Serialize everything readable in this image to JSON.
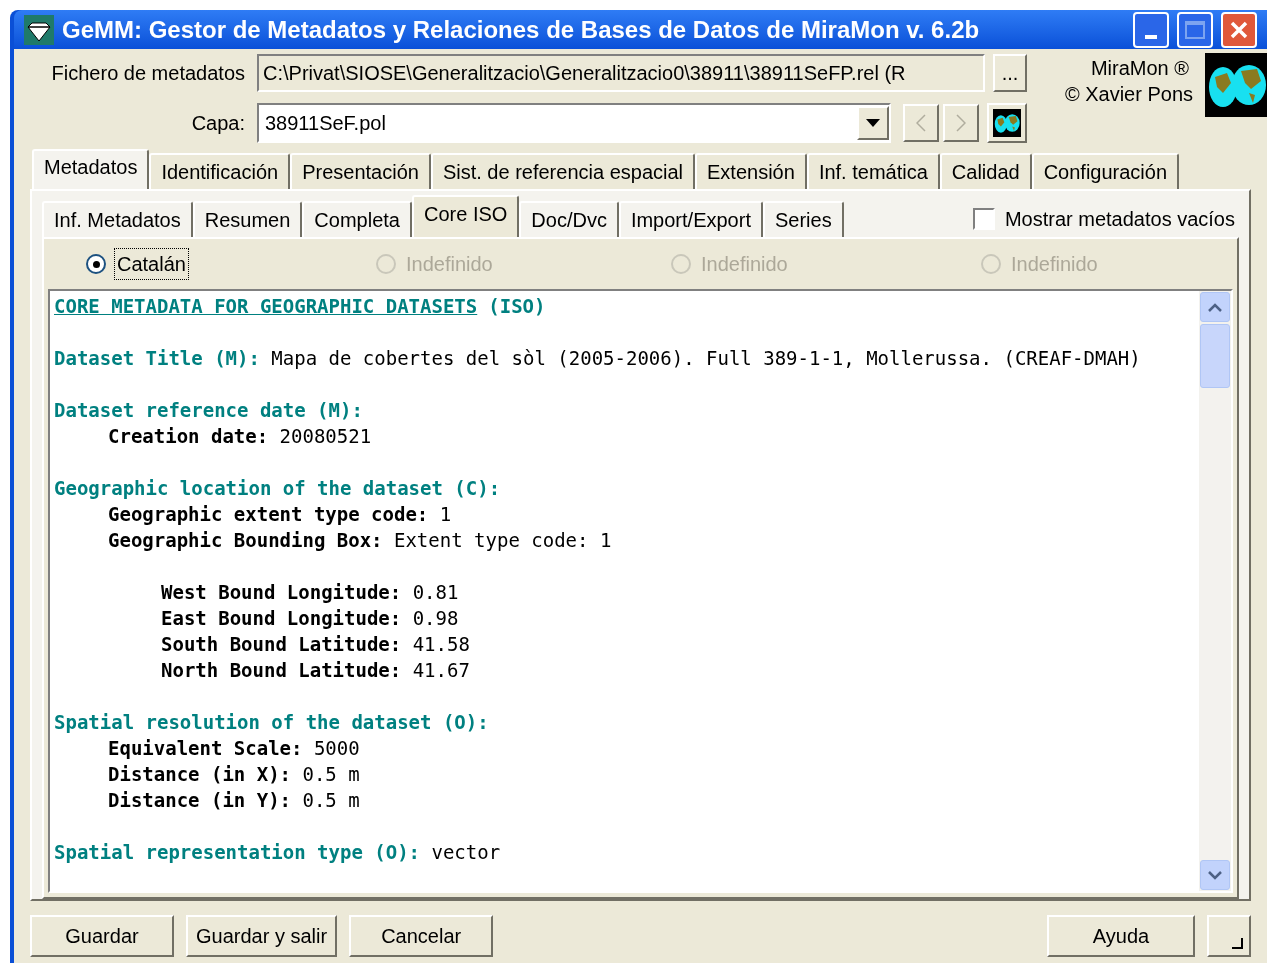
{
  "window": {
    "title": "GeMM: Gestor de Metadatos y Relaciones de Bases de Datos de MiraMon v. 6.2b"
  },
  "file_field": {
    "label": "Fichero de metadatos",
    "value": "C:\\Privat\\SIOSE\\Generalitzacio\\Generalitzacio0\\38911\\38911SeFP.rel (R",
    "browse_button": "..."
  },
  "brand": {
    "line_1": "MiraMon ®",
    "line_2": "© Xavier Pons"
  },
  "layer": {
    "label": "Capa:",
    "value": "38911SeF.pol"
  },
  "main_tabs": [
    {
      "label": "Metadatos",
      "selected": true
    },
    {
      "label": "Identificación",
      "selected": false
    },
    {
      "label": "Presentación",
      "selected": false
    },
    {
      "label": "Sist. de referencia espacial",
      "selected": false
    },
    {
      "label": "Extensión",
      "selected": false
    },
    {
      "label": "Inf. temática",
      "selected": false
    },
    {
      "label": "Calidad",
      "selected": false
    },
    {
      "label": "Configuración",
      "selected": false
    }
  ],
  "sub_tabs": [
    {
      "label": "Inf. Metadatos",
      "selected": false
    },
    {
      "label": "Resumen",
      "selected": false
    },
    {
      "label": "Completa",
      "selected": false
    },
    {
      "label": "Core ISO",
      "selected": true
    },
    {
      "label": "Doc/Dvc",
      "selected": false
    },
    {
      "label": "Import/Export",
      "selected": false
    },
    {
      "label": "Series",
      "selected": false
    }
  ],
  "show_empty": {
    "label": "Mostrar metadatos vacíos",
    "checked": false
  },
  "languages": [
    {
      "label": "Catalán",
      "selected": true,
      "disabled": false
    },
    {
      "label": "Indefinido",
      "selected": false,
      "disabled": true
    },
    {
      "label": "Indefinido",
      "selected": false,
      "disabled": true
    },
    {
      "label": "Indefinido",
      "selected": false,
      "disabled": true
    }
  ],
  "document": [
    {
      "kind": "title",
      "link": "CORE METADATA FOR GEOGRAPHIC DATASETS",
      "suffix": "(ISO)"
    },
    {
      "kind": "section",
      "heading": "Dataset Title (M):",
      "value": "Mapa de cobertes del sòl (2005-2006). Full 389-1-1, Mollerussa. (CREAF-DMAH)"
    },
    {
      "kind": "section",
      "heading": "Dataset reference date (M):",
      "children": [
        {
          "label": "Creation date:",
          "value": "20080521"
        }
      ]
    },
    {
      "kind": "section",
      "heading": "Geographic location of the dataset (C):",
      "children": [
        {
          "label": "Geographic extent type code:",
          "value": "1"
        },
        {
          "label": "Geographic Bounding Box:",
          "value": "Extent type code: 1",
          "children": [
            {
              "label": "West Bound Longitude:",
              "value": "0.81"
            },
            {
              "label": "East Bound Longitude:",
              "value": "0.98"
            },
            {
              "label": "South Bound Latitude:",
              "value": "41.58"
            },
            {
              "label": "North Bound Latitude:",
              "value": "41.67"
            }
          ]
        }
      ]
    },
    {
      "kind": "section",
      "heading": "Spatial resolution of the dataset (O):",
      "children": [
        {
          "label": "Equivalent Scale:",
          "value": "5000"
        },
        {
          "label": "Distance (in X):",
          "value": "0.5 m"
        },
        {
          "label": "Distance (in Y):",
          "value": "0.5 m"
        }
      ]
    },
    {
      "kind": "section",
      "heading": "Spatial representation type (O):",
      "value": "vector"
    }
  ],
  "buttons_left": [
    "Guardar",
    "Guardar y salir",
    "Cancelar"
  ],
  "buttons_right": [
    "Ayuda"
  ]
}
